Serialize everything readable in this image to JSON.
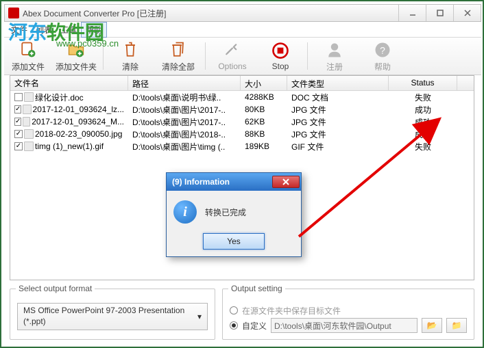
{
  "title": "Abex Document Converter Pro [已注册]",
  "menu": [
    "文件",
    "列表",
    "工具",
    "帮助"
  ],
  "toolbar": [
    {
      "label": "添加文件",
      "enabled": true
    },
    {
      "label": "添加文件夹",
      "enabled": true
    },
    {
      "label": "清除",
      "enabled": true
    },
    {
      "label": "清除全部",
      "enabled": true
    },
    {
      "label": "Options",
      "enabled": false
    },
    {
      "label": "Stop",
      "enabled": true
    },
    {
      "label": "注册",
      "enabled": false
    },
    {
      "label": "帮助",
      "enabled": false
    }
  ],
  "columns": [
    "文件名",
    "路径",
    "大小",
    "文件类型",
    "Status"
  ],
  "rows": [
    {
      "checked": false,
      "name": "绿化设计.doc",
      "path": "D:\\tools\\桌面\\说明书\\绿..",
      "size": "4288KB",
      "type": "DOC 文档",
      "status": "失败"
    },
    {
      "checked": true,
      "name": "2017-12-01_093624_lz...",
      "path": "D:\\tools\\桌面\\图片\\2017-..",
      "size": "80KB",
      "type": "JPG 文件",
      "status": "成功"
    },
    {
      "checked": true,
      "name": "2017-12-01_093624_M...",
      "path": "D:\\tools\\桌面\\图片\\2017-..",
      "size": "62KB",
      "type": "JPG 文件",
      "status": "成功"
    },
    {
      "checked": true,
      "name": "2018-02-23_090050.jpg",
      "path": "D:\\tools\\桌面\\图片\\2018-..",
      "size": "88KB",
      "type": "JPG 文件",
      "status": "成功"
    },
    {
      "checked": true,
      "name": "timg (1)_new(1).gif",
      "path": "D:\\tools\\桌面\\图片\\timg (..",
      "size": "189KB",
      "type": "GIF 文件",
      "status": "失败"
    }
  ],
  "outputFormat": {
    "legend": "Select output format",
    "value": "MS Office PowerPoint 97-2003 Presentation (*.ppt)"
  },
  "outputSetting": {
    "legend": "Output setting",
    "opt1": "在源文件夹中保存目标文件",
    "opt2": "自定义",
    "path": "D:\\tools\\桌面\\河东软件园\\Output"
  },
  "dialog": {
    "title": "(9)  Information",
    "msg": "转换已完成",
    "yes": "Yes"
  },
  "watermark": {
    "brand1": "河东",
    "brand2": "软件园",
    "url": "www.pc0359.cn"
  }
}
